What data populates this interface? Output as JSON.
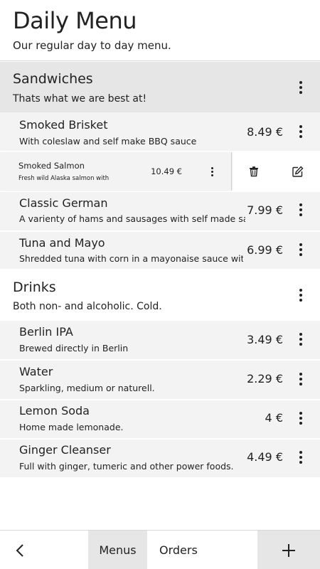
{
  "header": {
    "title": "Daily Menu",
    "subtitle": "Our regular day to day menu."
  },
  "sections": [
    {
      "name": "Sandwiches",
      "description": "Thats what we are best at!",
      "items": [
        {
          "name": "Smoked Brisket",
          "description": "With coleslaw and self make BBQ sauce",
          "price": "8.49 €"
        },
        {
          "name": "Smoked Salmon",
          "description": "Fresh wild Alaska salmon with h",
          "price": "10.49 €"
        },
        {
          "name": "Classic German",
          "description": "A varienty of hams and sausages with self made sauerkraut",
          "price": "7.99 €"
        },
        {
          "name": "Tuna and Mayo",
          "description": "Shredded tuna with corn in a mayonaise sauce with onions",
          "price": "6.99 €"
        }
      ]
    },
    {
      "name": "Drinks",
      "description": "Both non- and alcoholic. Cold.",
      "items": [
        {
          "name": "Berlin IPA",
          "description": "Brewed directly in Berlin",
          "price": "3.49 €"
        },
        {
          "name": "Water",
          "description": "Sparkling, medium or naturell.",
          "price": "2.29 €"
        },
        {
          "name": "Lemon Soda",
          "description": "Home made lemonade.",
          "price": "4 €"
        },
        {
          "name": "Ginger Cleanser",
          "description": "Full with ginger, tumeric and other power foods.",
          "price": "4.49 €"
        }
      ]
    }
  ],
  "swipe_actions": {
    "delete_icon": "trash-icon",
    "edit_icon": "edit-icon"
  },
  "bottom_bar": {
    "back_icon": "chevron-left-icon",
    "menus_label": "Menus",
    "orders_label": "Orders",
    "add_icon": "plus-icon"
  },
  "colors": {
    "section_bg": "#e6e6e6",
    "item_bg": "#f3f3f3",
    "text": "#222222"
  }
}
